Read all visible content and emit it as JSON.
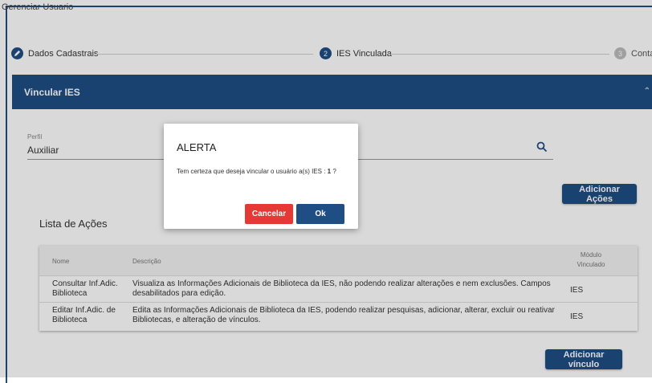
{
  "window": {
    "title": "Gerenciar Usuario"
  },
  "stepper": {
    "steps": [
      {
        "number": "",
        "label": "Dados Cadastrais"
      },
      {
        "number": "2",
        "label": "IES Vinculada"
      },
      {
        "number": "3",
        "label": "Conta"
      }
    ]
  },
  "panel": {
    "title": "Vincular IES"
  },
  "perfil": {
    "label": "Perfil",
    "value": "Auxiliar"
  },
  "buttons": {
    "adicionar_acoes": "Adicionar Ações",
    "adicionar_vinculo": "Adicionar vínculo"
  },
  "lista": {
    "title": "Lista de Ações",
    "headers": {
      "nome": "Nome",
      "descricao": "Descrição",
      "modulo_line1": "Módulo",
      "modulo_line2": "Vinculado"
    },
    "rows": [
      {
        "nome": "Consultar Inf.Adic. Biblioteca",
        "descricao": "Visualiza as Informações Adicionais de Biblioteca da IES, não podendo realizar alterações e nem exclusões. Campos desabilitados para edição.",
        "modulo": "IES"
      },
      {
        "nome": "Editar Inf.Adic. de Biblioteca",
        "descricao": "Edita as Informações Adicionais de Biblioteca da IES, podendo realizar pesquisas, adicionar, alterar, excluir ou reativar Bibliotecas, e alteração de vínculos.",
        "modulo": "IES"
      }
    ]
  },
  "modal": {
    "title": "ALERTA",
    "message": "Tem certeza que deseja vincular o usuário a(s) IES :",
    "count": "1",
    "suffix": " ?",
    "cancel_label": "Cancelar",
    "ok_label": "Ok"
  },
  "colors": {
    "primary": "#1f4e85",
    "danger": "#e53935"
  }
}
